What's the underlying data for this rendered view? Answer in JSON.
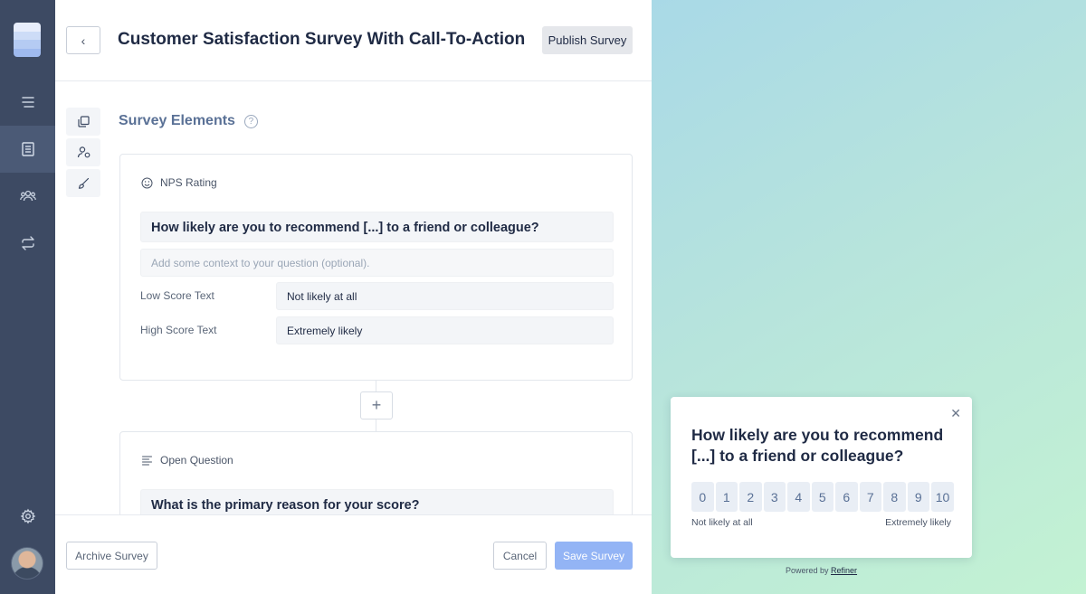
{
  "sidebar": {
    "logo_colors": [
      "#e8eefc",
      "#cddcf7",
      "#b5cbf3",
      "#9fbaef"
    ],
    "items": [
      {
        "name": "menu-icon"
      },
      {
        "name": "surveys-icon"
      },
      {
        "name": "contacts-icon"
      },
      {
        "name": "integrations-icon"
      },
      {
        "name": "settings-icon"
      }
    ],
    "accent": "#3d4a63"
  },
  "header": {
    "back_label": "‹",
    "title": "Customer Satisfaction Survey With Call-To-Action",
    "publish_label": "Publish Survey"
  },
  "editor": {
    "section_title": "Survey Elements",
    "help_label": "?",
    "add_label": "+",
    "nps_card": {
      "type_label": "NPS Rating",
      "question": "How likely are you to recommend [...] to a friend or colleague?",
      "context_placeholder": "Add some context to your question (optional).",
      "low_label": "Low Score Text",
      "low_value": "Not likely at all",
      "high_label": "High Score Text",
      "high_value": "Extremely likely"
    },
    "open_card": {
      "type_label": "Open Question",
      "question": "What is the primary reason for your score?"
    }
  },
  "footer": {
    "archive_label": "Archive Survey",
    "cancel_label": "Cancel",
    "save_label": "Save Survey"
  },
  "preview": {
    "close_label": "✕",
    "question": "How likely are you to recommend [...] to a friend or colleague?",
    "scale": [
      "0",
      "1",
      "2",
      "3",
      "4",
      "5",
      "6",
      "7",
      "8",
      "9",
      "10"
    ],
    "low_text": "Not likely at all",
    "high_text": "Extremely likely",
    "powered_prefix": "Powered by",
    "powered_brand": "Refiner"
  }
}
